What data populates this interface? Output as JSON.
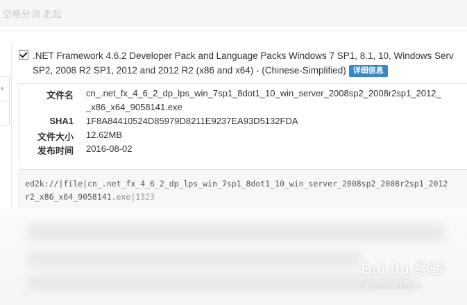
{
  "header": {
    "title": "空格分词 走起"
  },
  "item": {
    "checked": true,
    "title_line1": ".NET Framework 4.6.2 Developer Pack and Language Packs Windows 7 SP1, 8.1, 10, Windows Serv",
    "title_line2": "SP2, 2008 R2 SP1, 2012 and 2012 R2 (x86 and x64) - (Chinese-Simplified)",
    "detail_label": "详细信息"
  },
  "info": {
    "filename_label": "文件名",
    "filename_line1": "cn_.net_fx_4_6_2_dp_lps_win_7sp1_8dot1_10_win_server_2008sp2_2008r2sp1_2012_",
    "filename_line2": "_x86_x64_9058141.exe",
    "sha1_label": "SHA1",
    "sha1_value": "1F8A84410524D85979D8211E9237EA93D5132FDA",
    "size_label": "文件大小",
    "size_value": "12.62MB",
    "date_label": "发布时间",
    "date_value": "2016-08-02"
  },
  "link": {
    "line1": "ed2k://|file|cn_.net_fx_4_6_2_dp_lps_win_7sp1_8dot1_10_win_server_2008sp2_2008r2sp1_2012",
    "line2": "r2_x86_x64_9058141.exe|1323"
  },
  "watermark": {
    "text": "Bai du 经验",
    "url": "jingyan.baidu.com"
  },
  "colors": {
    "accent": "#3a87c8",
    "text": "#333333",
    "link_bg": "#f7f7f7"
  }
}
